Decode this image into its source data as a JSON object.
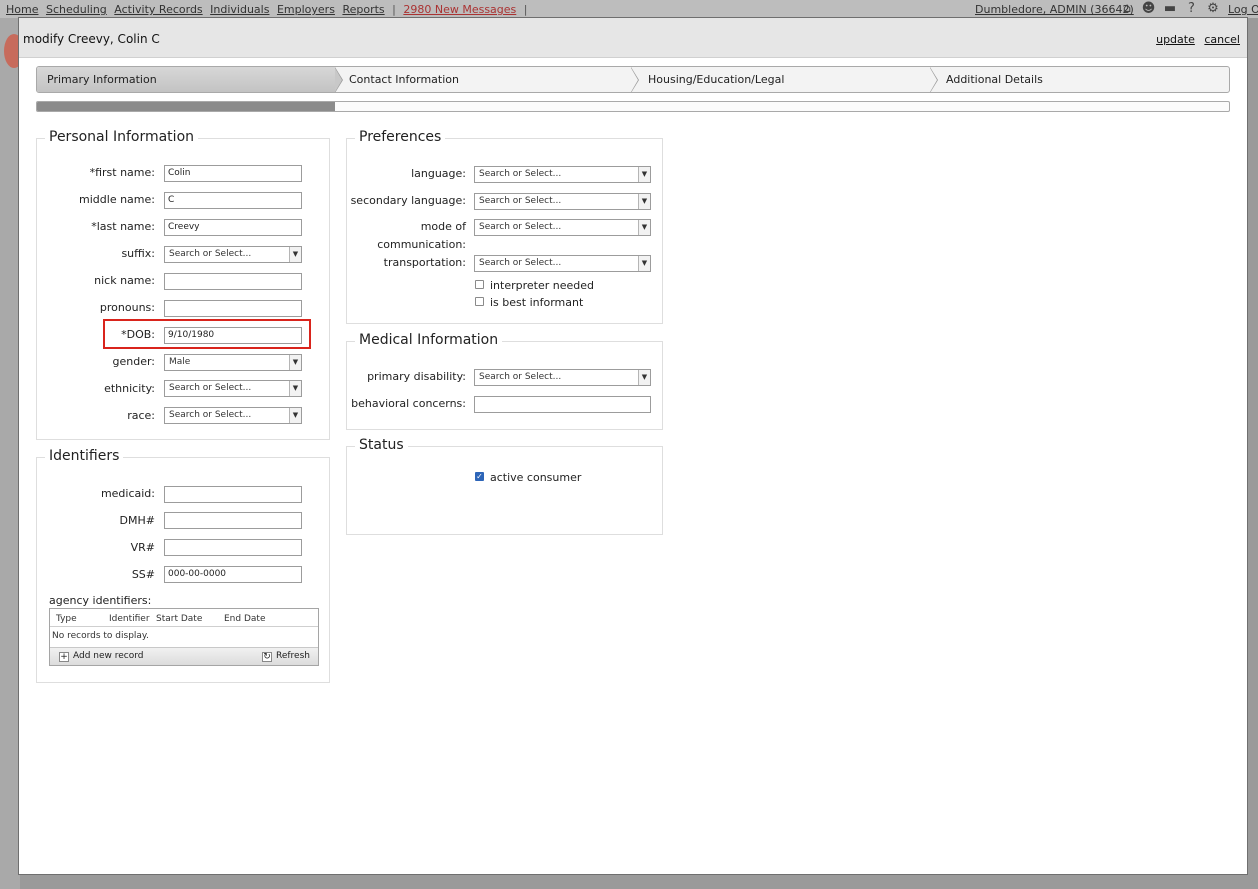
{
  "background_nav": {
    "links": [
      "Home",
      "Scheduling",
      "Activity Records",
      "Individuals",
      "Employers",
      "Reports"
    ],
    "separator": "|",
    "messages": "2980 New Messages",
    "user": "Dumbledore, ADMIN (36642)",
    "logoff": "Log Off",
    "icons": [
      "home-icon",
      "people-icon",
      "folder-icon",
      "help-icon",
      "gear-icon"
    ]
  },
  "modal": {
    "title": "modify Creevy, Colin C",
    "update_label": "update",
    "cancel_label": "cancel"
  },
  "steps": [
    "Primary Information",
    "Contact Information",
    "Housing/Education/Legal",
    "Additional Details"
  ],
  "progress": {
    "fraction": 0.25
  },
  "personal": {
    "title": "Personal Information",
    "first_name": {
      "label": "*first name:",
      "value": "Colin"
    },
    "middle_name": {
      "label": "middle name:",
      "value": "C"
    },
    "last_name": {
      "label": "*last name:",
      "value": "Creevy"
    },
    "suffix": {
      "label": "suffix:",
      "value": "Search or Select..."
    },
    "nick_name": {
      "label": "nick name:",
      "value": ""
    },
    "pronouns": {
      "label": "pronouns:",
      "value": ""
    },
    "dob": {
      "label": "*DOB:",
      "value": "9/10/1980"
    },
    "gender": {
      "label": "gender:",
      "value": "Male"
    },
    "ethnicity": {
      "label": "ethnicity:",
      "value": "Search or Select..."
    },
    "race": {
      "label": "race:",
      "value": "Search or Select..."
    }
  },
  "identifiers": {
    "title": "Identifiers",
    "medicaid": {
      "label": "medicaid:",
      "value": ""
    },
    "dmh": {
      "label": "DMH#",
      "value": ""
    },
    "vr": {
      "label": "VR#",
      "value": ""
    },
    "ss": {
      "label": "SS#",
      "value": "",
      "placeholder": "000-00-0000"
    },
    "agency_label": "agency identifiers:",
    "grid": {
      "columns": [
        "Type",
        "Identifier",
        "Start Date",
        "End Date"
      ],
      "empty_text": "No records to display.",
      "add_label": "Add new record",
      "refresh_label": "Refresh"
    }
  },
  "preferences": {
    "title": "Preferences",
    "language": {
      "label": "language:",
      "value": "Search or Select..."
    },
    "secondary_language": {
      "label": "secondary language:",
      "value": "Search or Select..."
    },
    "mode_of_communication": {
      "label_line1": "mode of",
      "label_line2": "communication:",
      "value": "Search or Select..."
    },
    "transportation": {
      "label": "transportation:",
      "value": "Search or Select..."
    },
    "interpreter_needed": {
      "label": "interpreter needed",
      "checked": false
    },
    "best_informant": {
      "label": "is best informant",
      "checked": false
    }
  },
  "medical": {
    "title": "Medical Information",
    "primary_disability": {
      "label": "primary disability:",
      "value": "Search or Select..."
    },
    "behavioral_concerns": {
      "label": "behavioral concerns:",
      "value": ""
    }
  },
  "status": {
    "title": "Status",
    "active_consumer": {
      "label": "active consumer",
      "checked": true
    }
  }
}
